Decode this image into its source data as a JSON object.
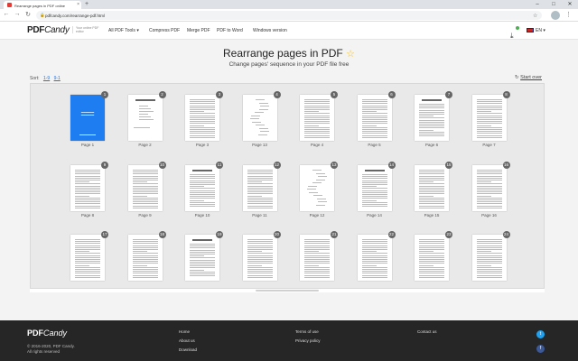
{
  "browser": {
    "tab_title": "Rearrange pages in PDF online",
    "tab_close": "×",
    "new_tab": "+",
    "url": "pdfcandy.com/rearrange-pdf.html",
    "icons": [
      "back-icon",
      "forward-icon",
      "reload-icon",
      "lock-icon",
      "star-icon",
      "menu-icon"
    ]
  },
  "header": {
    "logo_main": "PDF",
    "logo_script": "Candy",
    "tagline": "Your online PDF editor",
    "nav": [
      {
        "label": "All PDF Tools"
      },
      {
        "label": "Compress PDF"
      },
      {
        "label": "Merge PDF"
      },
      {
        "label": "PDF to Word"
      },
      {
        "label": "Windows version"
      }
    ],
    "language": "EN"
  },
  "main": {
    "title": "Rearrange pages in PDF",
    "subtitle": "Change pages' sequence in your PDF file free",
    "sort_label": "Sort:",
    "sort_options": [
      "1-9",
      "9-1"
    ],
    "start_over": "Start over",
    "pages": [
      {
        "num": "1",
        "label": "Page 1",
        "style": "blue"
      },
      {
        "num": "2",
        "label": "Page 2",
        "style": "toc"
      },
      {
        "num": "3",
        "label": "Page 3",
        "style": "text"
      },
      {
        "num": "4",
        "label": "Page 13",
        "style": "dna"
      },
      {
        "num": "5",
        "label": "Page 4",
        "style": "text"
      },
      {
        "num": "6",
        "label": "Page 5",
        "style": "text"
      },
      {
        "num": "7",
        "label": "Page 6",
        "style": "heading"
      },
      {
        "num": "8",
        "label": "Page 7",
        "style": "text"
      },
      {
        "num": "9",
        "label": "Page 8",
        "style": "text"
      },
      {
        "num": "10",
        "label": "Page 9",
        "style": "text"
      },
      {
        "num": "11",
        "label": "Page 10",
        "style": "heading"
      },
      {
        "num": "12",
        "label": "Page 11",
        "style": "text"
      },
      {
        "num": "13",
        "label": "Page 12",
        "style": "dna"
      },
      {
        "num": "14",
        "label": "Page 14",
        "style": "heading"
      },
      {
        "num": "15",
        "label": "Page 15",
        "style": "text"
      },
      {
        "num": "16",
        "label": "Page 16",
        "style": "text"
      },
      {
        "num": "17",
        "label": "",
        "style": "text"
      },
      {
        "num": "18",
        "label": "",
        "style": "text"
      },
      {
        "num": "19",
        "label": "",
        "style": "heading"
      },
      {
        "num": "20",
        "label": "",
        "style": "text"
      },
      {
        "num": "21",
        "label": "",
        "style": "text"
      },
      {
        "num": "22",
        "label": "",
        "style": "text"
      },
      {
        "num": "23",
        "label": "",
        "style": "text"
      },
      {
        "num": "24",
        "label": "",
        "style": "text"
      }
    ]
  },
  "footer": {
    "logo_main": "PDF",
    "logo_script": "Candy",
    "copyright": "© 2016-2020, PDF Candy.",
    "rights": "All rights reserved",
    "col1": [
      "Home",
      "About us",
      "Download"
    ],
    "col2": [
      "Terms of use",
      "Privacy policy"
    ],
    "col3": [
      "Contact us"
    ]
  },
  "colors": {
    "accent_blue": "#1e7df0",
    "star": "#f5c518",
    "footer_bg": "#262626"
  }
}
